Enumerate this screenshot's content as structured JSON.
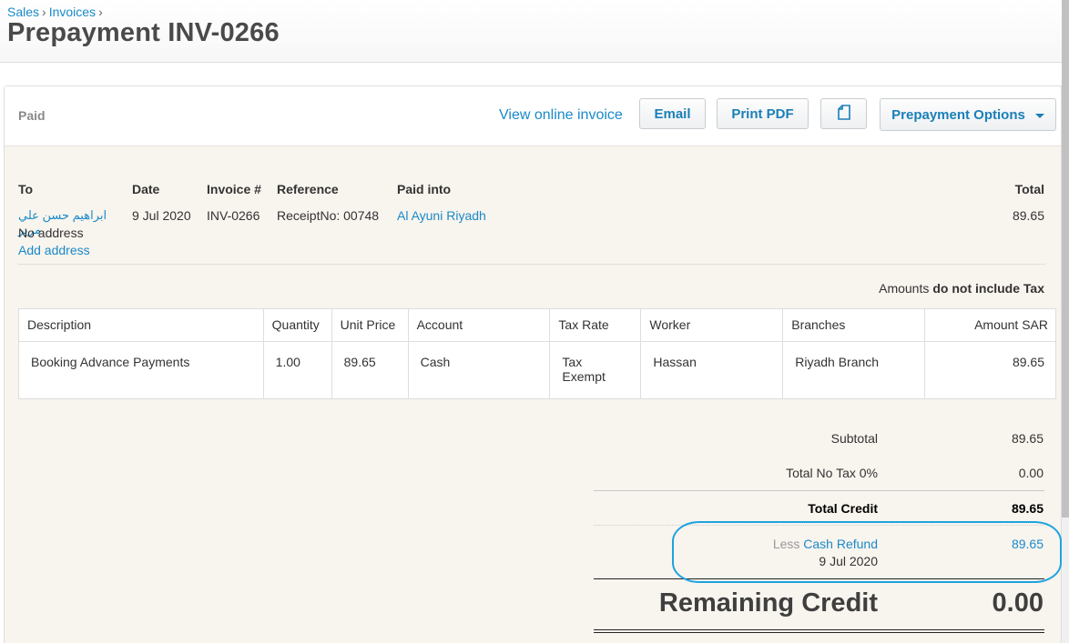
{
  "breadcrumb": {
    "items": [
      "Sales",
      "Invoices"
    ],
    "separator": "›"
  },
  "header": {
    "title": "Prepayment INV-0266"
  },
  "toolbar": {
    "status": "Paid",
    "view_online_label": "View online invoice",
    "email_label": "Email",
    "print_pdf_label": "Print PDF",
    "document_icon": "document-icon",
    "options_label": "Prepayment Options",
    "options_icon": "caret-down-icon"
  },
  "meta": {
    "to_label": "To",
    "to_name": "ابراهيم حسن علي مرير",
    "no_address": "No address",
    "add_address": "Add address",
    "date_label": "Date",
    "date": "9 Jul 2020",
    "invoice_label": "Invoice #",
    "invoice_number": "INV-0266",
    "reference_label": "Reference",
    "reference": "ReceiptNo: 00748",
    "paid_into_label": "Paid into",
    "paid_into": "Al Ayuni Riyadh",
    "total_label": "Total",
    "total": "89.65"
  },
  "tax_note": {
    "prefix": "Amounts",
    "emphasis": "do not include Tax"
  },
  "table": {
    "headers": [
      "Description",
      "Quantity",
      "Unit Price",
      "Account",
      "Tax Rate",
      "Worker",
      "Branches",
      "Amount SAR"
    ],
    "rows": [
      [
        "Booking Advance Payments",
        "1.00",
        "89.65",
        "Cash",
        "Tax Exempt",
        "Hassan",
        "Riyadh Branch",
        "89.65"
      ]
    ]
  },
  "totals": {
    "subtotal_label": "Subtotal",
    "subtotal": "89.65",
    "no_tax_label": "Total No Tax 0%",
    "no_tax": "0.00",
    "total_credit_label": "Total Credit",
    "total_credit": "89.65",
    "less_label": "Less",
    "refund_link": "Cash Refund",
    "refund_date": "9 Jul 2020",
    "refund_amount": "89.65",
    "remaining_label": "Remaining Credit",
    "remaining": "0.00"
  },
  "colors": {
    "link": "#1a8ac9",
    "button_text": "#1a7fb8",
    "panel_bg": "#f8f4ee",
    "highlight": "#1ea3e0"
  }
}
